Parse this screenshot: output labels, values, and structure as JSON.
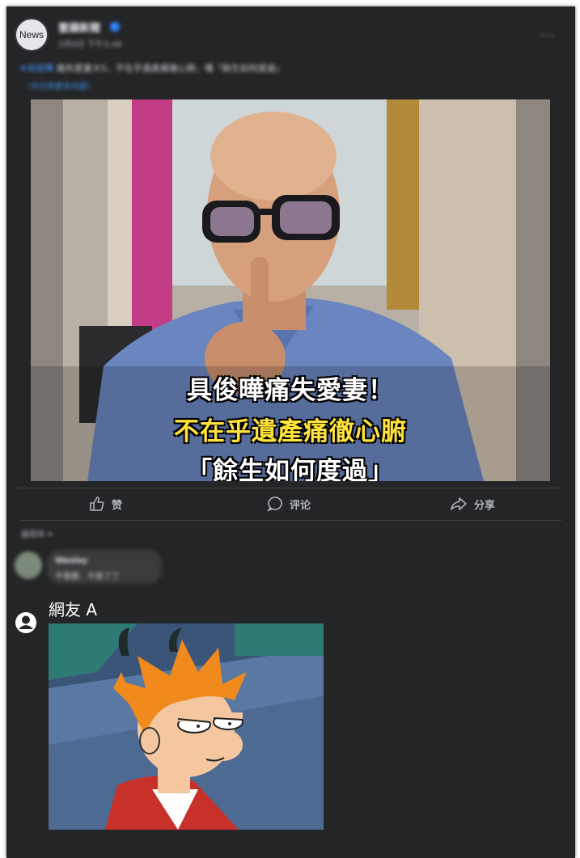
{
  "post": {
    "avatar_label": "News",
    "page_name": "壹蘋新聞",
    "timestamp": "5月9日 下午3:48",
    "privacy_icon": "globe-icon",
    "more_icon": "···",
    "text_tag": "#具俊曄",
    "text_body": "痛失愛妻大S，不在乎遺產痛徹心肺，嘆「餘生如何度過」",
    "link": "（今日有更多內容）"
  },
  "photo": {
    "caption_line1": "具俊曄痛失愛妻！",
    "caption_line2": "不在乎遺產痛徹心腑",
    "caption_line3": "「餘生如何度過」",
    "caption_color_highlight": "#ffe23a"
  },
  "actions": {
    "like_label": "赞",
    "comment_label": "评论",
    "share_label": "分享"
  },
  "comments": {
    "sort_label": "最相关 ▾",
    "first": {
      "name": "Wesley",
      "text": "不需要、不爱了了"
    },
    "second": {
      "name": "網友 A"
    }
  },
  "colors": {
    "card_bg": "#242526",
    "text_secondary": "#b0b3b8",
    "accent_blue": "#2d88ff"
  }
}
